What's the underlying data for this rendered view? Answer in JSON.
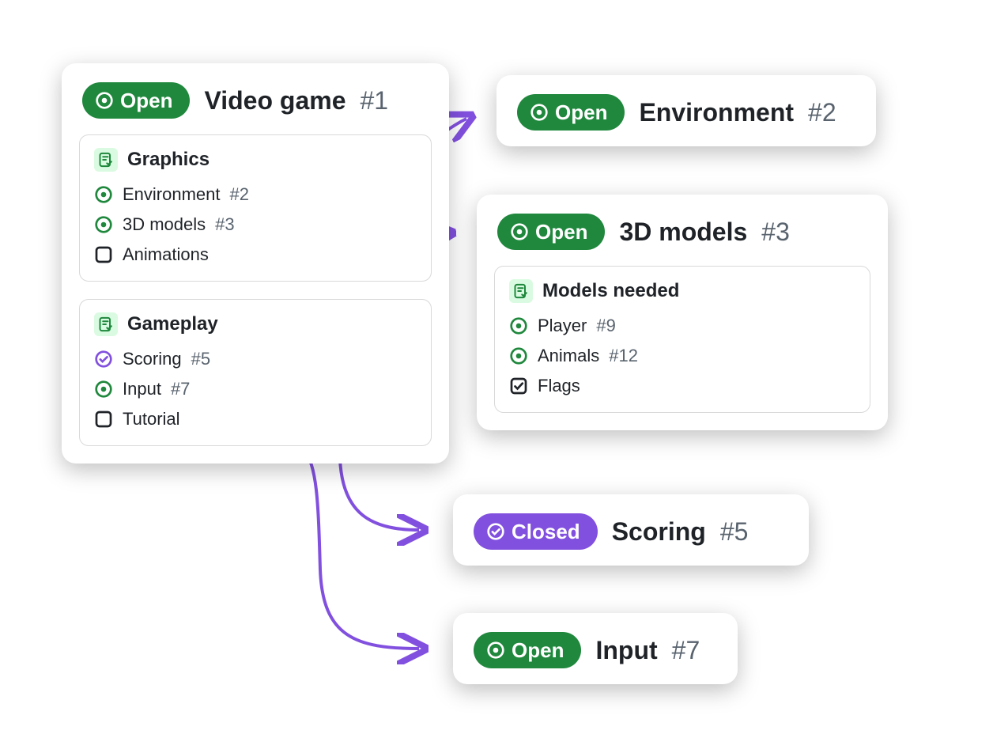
{
  "colors": {
    "open": "#1F883D",
    "closed": "#8250DF",
    "arrow": "#8250DF"
  },
  "main": {
    "status": "open",
    "status_label": "Open",
    "title": "Video game",
    "ref": "#1",
    "tasklists": [
      {
        "title": "Graphics",
        "items": [
          {
            "icon": "open-issue",
            "label": "Environment",
            "ref": "#2"
          },
          {
            "icon": "open-issue",
            "label": "3D models",
            "ref": "#3"
          },
          {
            "icon": "checkbox-empty",
            "label": "Animations",
            "ref": ""
          }
        ]
      },
      {
        "title": "Gameplay",
        "items": [
          {
            "icon": "closed-issue",
            "label": "Scoring",
            "ref": "#5"
          },
          {
            "icon": "open-issue",
            "label": "Input",
            "ref": "#7"
          },
          {
            "icon": "checkbox-empty",
            "label": "Tutorial",
            "ref": ""
          }
        ]
      }
    ]
  },
  "linked": [
    {
      "id": "environment",
      "status": "open",
      "status_label": "Open",
      "title": "Environment",
      "ref": "#2",
      "tasklists": []
    },
    {
      "id": "models",
      "status": "open",
      "status_label": "Open",
      "title": "3D models",
      "ref": "#3",
      "tasklists": [
        {
          "title": "Models needed",
          "items": [
            {
              "icon": "open-issue",
              "label": "Player",
              "ref": "#9"
            },
            {
              "icon": "open-issue",
              "label": "Animals",
              "ref": "#12"
            },
            {
              "icon": "checkbox-checked",
              "label": "Flags",
              "ref": ""
            }
          ]
        }
      ]
    },
    {
      "id": "scoring",
      "status": "closed",
      "status_label": "Closed",
      "title": "Scoring",
      "ref": "#5",
      "tasklists": []
    },
    {
      "id": "input",
      "status": "open",
      "status_label": "Open",
      "title": "Input",
      "ref": "#7",
      "tasklists": []
    }
  ]
}
